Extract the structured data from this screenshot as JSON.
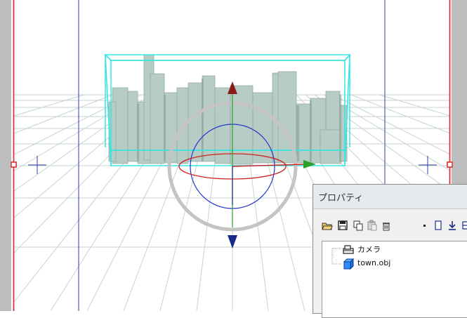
{
  "viewport": {
    "grid_color": "#c7d3d3",
    "guide_color": "#2f3fa6",
    "frame_color": "#e03030",
    "bbox_color": "#33e5e5",
    "model_color": "#b6ccc4",
    "gizmo": {
      "x_axis_color": "#2aa02a",
      "y_axis_color": "#8b1a1a",
      "z_axis_color": "#1a2a8b",
      "ring_outer_color": "#c4c4c4",
      "ring_red_color": "#cc2222",
      "ring_blue_color": "#2233cc"
    }
  },
  "panel": {
    "title": "プロパティ",
    "toolbar": [
      {
        "name": "open-folder-icon"
      },
      {
        "name": "save-icon"
      },
      {
        "name": "copy-icon"
      },
      {
        "name": "paste-icon"
      },
      {
        "name": "trash-icon"
      },
      {
        "name": "dot-icon"
      },
      {
        "name": "new-page-icon"
      },
      {
        "name": "download-icon"
      },
      {
        "name": "collapse-icon"
      }
    ],
    "tree": {
      "items": [
        {
          "label": "カメラ",
          "icon": "camera-icon"
        },
        {
          "label": "town.obj",
          "icon": "cube-icon"
        }
      ]
    }
  }
}
